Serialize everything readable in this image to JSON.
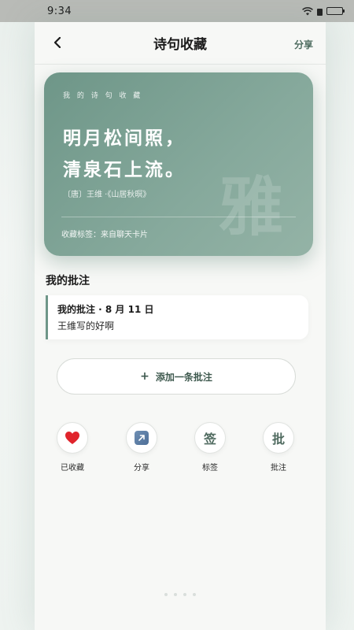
{
  "status_bar": {
    "time": "9:34"
  },
  "nav": {
    "title": "诗句收藏",
    "share": "分享"
  },
  "poem_card": {
    "caption": "我 的 诗 句 收 藏",
    "line1": "明月松间照，",
    "line2": "清泉石上流。",
    "source": "〔唐〕王维 ·《山居秋暝》",
    "tag": "收藏标签：来自聊天卡片",
    "watermark": "雅",
    "accent_color": "#6e9688"
  },
  "notes_section": {
    "title": "我的批注",
    "notes": [
      {
        "heading": "我的批注 · 8 月 11 日",
        "text": "王维写的好啊"
      }
    ]
  },
  "add_note": {
    "plus": "+",
    "label": "添加一条批注"
  },
  "actions": [
    {
      "icon": "heart-icon",
      "label": "已收藏",
      "color": "#e0242c"
    },
    {
      "icon": "share-arrow-icon",
      "label": "分享"
    },
    {
      "icon": "tag-glyph-icon",
      "glyph": "签",
      "label": "标签"
    },
    {
      "icon": "annotate-glyph-icon",
      "glyph": "批",
      "label": "批注"
    }
  ]
}
